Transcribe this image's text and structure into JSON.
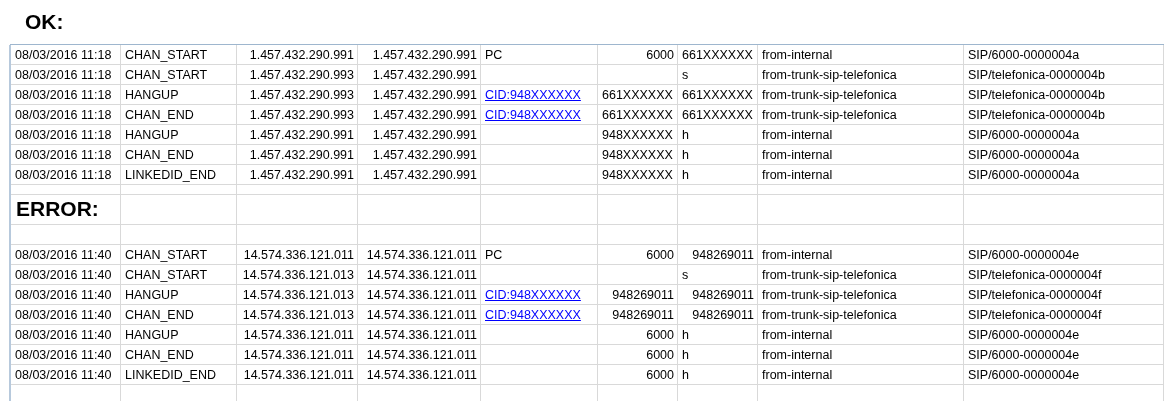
{
  "sections": [
    {
      "title": "OK:",
      "rows": [
        [
          {
            "text": "08/03/2016 11:18",
            "kind": "text"
          },
          {
            "text": "CHAN_START",
            "kind": "text"
          },
          {
            "text": "1.457.432.290.991",
            "kind": "number"
          },
          {
            "text": "1.457.432.290.991",
            "kind": "number"
          },
          {
            "text": "PC",
            "kind": "text"
          },
          {
            "text": "6000",
            "kind": "number"
          },
          {
            "text": "661XXXXXX",
            "kind": "text"
          },
          {
            "text": "from-internal",
            "kind": "text"
          },
          {
            "text": "SIP/6000-0000004a",
            "kind": "text"
          }
        ],
        [
          {
            "text": "08/03/2016 11:18",
            "kind": "text"
          },
          {
            "text": "CHAN_START",
            "kind": "text"
          },
          {
            "text": "1.457.432.290.993",
            "kind": "number"
          },
          {
            "text": "1.457.432.290.991",
            "kind": "number"
          },
          null,
          null,
          {
            "text": "s",
            "kind": "text"
          },
          {
            "text": "from-trunk-sip-telefonica",
            "kind": "text"
          },
          {
            "text": "SIP/telefonica-0000004b",
            "kind": "text"
          }
        ],
        [
          {
            "text": "08/03/2016 11:18",
            "kind": "text"
          },
          {
            "text": "HANGUP",
            "kind": "text"
          },
          {
            "text": "1.457.432.290.993",
            "kind": "number"
          },
          {
            "text": "1.457.432.290.991",
            "kind": "number"
          },
          {
            "text": "CID:948XXXXXX",
            "kind": "link"
          },
          {
            "text": "661XXXXXX",
            "kind": "text"
          },
          {
            "text": "661XXXXXX",
            "kind": "text"
          },
          {
            "text": "from-trunk-sip-telefonica",
            "kind": "text"
          },
          {
            "text": "SIP/telefonica-0000004b",
            "kind": "text"
          }
        ],
        [
          {
            "text": "08/03/2016 11:18",
            "kind": "text"
          },
          {
            "text": "CHAN_END",
            "kind": "text"
          },
          {
            "text": "1.457.432.290.993",
            "kind": "number"
          },
          {
            "text": "1.457.432.290.991",
            "kind": "number"
          },
          {
            "text": "CID:948XXXXXX",
            "kind": "link"
          },
          {
            "text": "661XXXXXX",
            "kind": "text"
          },
          {
            "text": "661XXXXXX",
            "kind": "text"
          },
          {
            "text": "from-trunk-sip-telefonica",
            "kind": "text"
          },
          {
            "text": "SIP/telefonica-0000004b",
            "kind": "text"
          }
        ],
        [
          {
            "text": "08/03/2016 11:18",
            "kind": "text"
          },
          {
            "text": "HANGUP",
            "kind": "text"
          },
          {
            "text": "1.457.432.290.991",
            "kind": "number"
          },
          {
            "text": "1.457.432.290.991",
            "kind": "number"
          },
          null,
          {
            "text": "948XXXXXX",
            "kind": "text"
          },
          {
            "text": "h",
            "kind": "text"
          },
          {
            "text": "from-internal",
            "kind": "text"
          },
          {
            "text": "SIP/6000-0000004a",
            "kind": "text"
          }
        ],
        [
          {
            "text": "08/03/2016 11:18",
            "kind": "text"
          },
          {
            "text": "CHAN_END",
            "kind": "text"
          },
          {
            "text": "1.457.432.290.991",
            "kind": "number"
          },
          {
            "text": "1.457.432.290.991",
            "kind": "number"
          },
          null,
          {
            "text": "948XXXXXX",
            "kind": "text"
          },
          {
            "text": "h",
            "kind": "text"
          },
          {
            "text": "from-internal",
            "kind": "text"
          },
          {
            "text": "SIP/6000-0000004a",
            "kind": "text"
          }
        ],
        [
          {
            "text": "08/03/2016 11:18",
            "kind": "text"
          },
          {
            "text": "LINKEDID_END",
            "kind": "text"
          },
          {
            "text": "1.457.432.290.991",
            "kind": "number"
          },
          {
            "text": "1.457.432.290.991",
            "kind": "number"
          },
          null,
          {
            "text": "948XXXXXX",
            "kind": "text"
          },
          {
            "text": "h",
            "kind": "text"
          },
          {
            "text": "from-internal",
            "kind": "text"
          },
          {
            "text": "SIP/6000-0000004a",
            "kind": "text"
          }
        ]
      ]
    },
    {
      "title": "ERROR:",
      "rows": [
        [
          {
            "text": "08/03/2016 11:40",
            "kind": "text"
          },
          {
            "text": "CHAN_START",
            "kind": "text"
          },
          {
            "text": "14.574.336.121.011",
            "kind": "number"
          },
          {
            "text": "14.574.336.121.011",
            "kind": "number"
          },
          {
            "text": "PC",
            "kind": "text"
          },
          {
            "text": "6000",
            "kind": "number"
          },
          {
            "text": "948269011",
            "kind": "number"
          },
          {
            "text": "from-internal",
            "kind": "text"
          },
          {
            "text": "SIP/6000-0000004e",
            "kind": "text"
          }
        ],
        [
          {
            "text": "08/03/2016 11:40",
            "kind": "text"
          },
          {
            "text": "CHAN_START",
            "kind": "text"
          },
          {
            "text": "14.574.336.121.013",
            "kind": "number"
          },
          {
            "text": "14.574.336.121.011",
            "kind": "number"
          },
          null,
          null,
          {
            "text": "s",
            "kind": "text"
          },
          {
            "text": "from-trunk-sip-telefonica",
            "kind": "text"
          },
          {
            "text": "SIP/telefonica-0000004f",
            "kind": "text"
          }
        ],
        [
          {
            "text": "08/03/2016 11:40",
            "kind": "text"
          },
          {
            "text": "HANGUP",
            "kind": "text"
          },
          {
            "text": "14.574.336.121.013",
            "kind": "number"
          },
          {
            "text": "14.574.336.121.011",
            "kind": "number"
          },
          {
            "text": "CID:948XXXXXX",
            "kind": "link"
          },
          {
            "text": "948269011",
            "kind": "number"
          },
          {
            "text": "948269011",
            "kind": "number"
          },
          {
            "text": "from-trunk-sip-telefonica",
            "kind": "text"
          },
          {
            "text": "SIP/telefonica-0000004f",
            "kind": "text"
          }
        ],
        [
          {
            "text": "08/03/2016 11:40",
            "kind": "text"
          },
          {
            "text": "CHAN_END",
            "kind": "text"
          },
          {
            "text": "14.574.336.121.013",
            "kind": "number"
          },
          {
            "text": "14.574.336.121.011",
            "kind": "number"
          },
          {
            "text": "CID:948XXXXXX",
            "kind": "link"
          },
          {
            "text": "948269011",
            "kind": "number"
          },
          {
            "text": "948269011",
            "kind": "number"
          },
          {
            "text": "from-trunk-sip-telefonica",
            "kind": "text"
          },
          {
            "text": "SIP/telefonica-0000004f",
            "kind": "text"
          }
        ],
        [
          {
            "text": "08/03/2016 11:40",
            "kind": "text"
          },
          {
            "text": "HANGUP",
            "kind": "text"
          },
          {
            "text": "14.574.336.121.011",
            "kind": "number"
          },
          {
            "text": "14.574.336.121.011",
            "kind": "number"
          },
          null,
          {
            "text": "6000",
            "kind": "number"
          },
          {
            "text": "h",
            "kind": "text"
          },
          {
            "text": "from-internal",
            "kind": "text"
          },
          {
            "text": "SIP/6000-0000004e",
            "kind": "text"
          }
        ],
        [
          {
            "text": "08/03/2016 11:40",
            "kind": "text"
          },
          {
            "text": "CHAN_END",
            "kind": "text"
          },
          {
            "text": "14.574.336.121.011",
            "kind": "number"
          },
          {
            "text": "14.574.336.121.011",
            "kind": "number"
          },
          null,
          {
            "text": "6000",
            "kind": "number"
          },
          {
            "text": "h",
            "kind": "text"
          },
          {
            "text": "from-internal",
            "kind": "text"
          },
          {
            "text": "SIP/6000-0000004e",
            "kind": "text"
          }
        ],
        [
          {
            "text": "08/03/2016 11:40",
            "kind": "text"
          },
          {
            "text": "LINKEDID_END",
            "kind": "text"
          },
          {
            "text": "14.574.336.121.011",
            "kind": "number"
          },
          {
            "text": "14.574.336.121.011",
            "kind": "number"
          },
          null,
          {
            "text": "6000",
            "kind": "number"
          },
          {
            "text": "h",
            "kind": "text"
          },
          {
            "text": "from-internal",
            "kind": "text"
          },
          {
            "text": "SIP/6000-0000004e",
            "kind": "text"
          }
        ]
      ]
    }
  ]
}
